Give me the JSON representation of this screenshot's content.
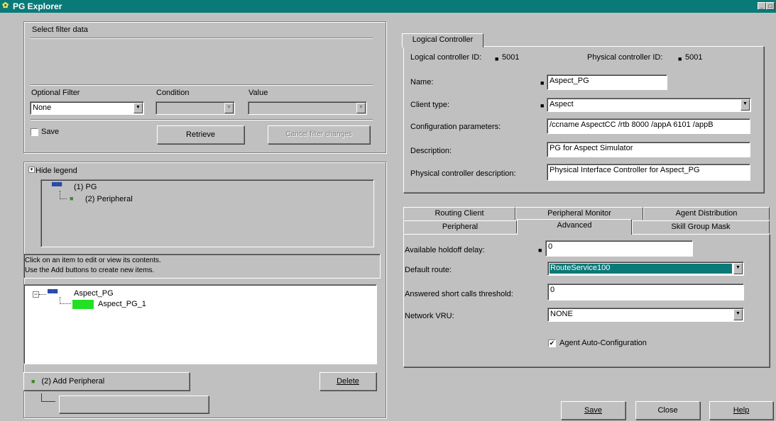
{
  "window": {
    "title": "PG Explorer",
    "title_icon": "app-icon",
    "controls": [
      "_",
      "□"
    ]
  },
  "filter": {
    "title": "Select filter data",
    "optional_filter_label": "Optional Filter",
    "condition_label": "Condition",
    "value_label": "Value",
    "optional_filter_value": "None",
    "condition_value": "",
    "value_value": "",
    "save_label": "Save",
    "retrieve_label": "Retrieve",
    "cancel_label": "Cancel filter changes"
  },
  "legend": {
    "toggle_label": "Hide legend",
    "item1": "(1) PG",
    "item2": "(2) Peripheral"
  },
  "help": {
    "line1": "Click on an item to edit or view its contents.",
    "line2": "Use the Add buttons to create new items."
  },
  "tree": {
    "root": "Aspect_PG",
    "child": "Aspect_PG_1"
  },
  "buttons": {
    "add_peripheral": "(2) Add Peripheral",
    "delete": "Delete",
    "save": "Save",
    "close": "Close",
    "help": "Help"
  },
  "logical": {
    "tab": "Logical Controller",
    "lc_id_label": "Logical controller ID:",
    "lc_id": "5001",
    "pc_id_label": "Physical controller ID:",
    "pc_id": "5001",
    "name_label": "Name:",
    "name": "Aspect_PG",
    "client_type_label": "Client type:",
    "client_type": "Aspect",
    "config_label": "Configuration parameters:",
    "config": "/ccname AspectCC /rtb 8000 /appA 6101 /appB",
    "desc_label": "Description:",
    "desc": "PG for Aspect Simulator",
    "phys_desc_label": "Physical controller description:",
    "phys_desc": "Physical Interface Controller for Aspect_PG"
  },
  "tabs": {
    "row1": [
      "Routing Client",
      "Peripheral Monitor",
      "Agent Distribution"
    ],
    "row2": [
      "Peripheral",
      "Advanced",
      "Skill Group Mask"
    ],
    "active": "Advanced"
  },
  "advanced": {
    "holdoff_label": "Available holdoff delay:",
    "holdoff": "0",
    "default_route_label": "Default route:",
    "default_route": "RouteService100",
    "short_calls_label": "Answered short calls threshold:",
    "short_calls": "0",
    "vru_label": "Network VRU:",
    "vru": "NONE",
    "auto_config_label": "Agent Auto-Configuration"
  },
  "colors": {
    "title_bar": "#0a7a78",
    "selection": "#0a7a78",
    "tree_highlight": "#22e022"
  }
}
